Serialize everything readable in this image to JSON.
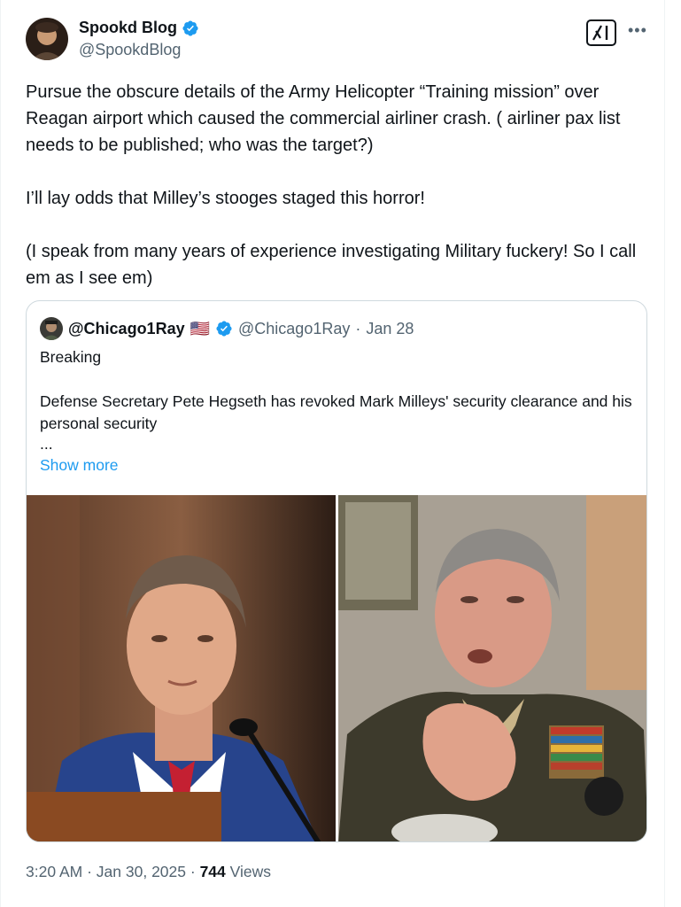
{
  "author": {
    "name": "Spookd Blog",
    "handle": "@SpookdBlog",
    "avatar": "avatar-photo"
  },
  "post": {
    "paragraphs": [
      "Pursue the obscure details of the Army Helicopter “Training mission” over Reagan airport which caused the commercial airliner crash. ( airliner pax list needs to be published; who was the target?)",
      "I’ll lay odds that Milley’s stooges staged this horror!",
      "(I speak from many years of experience investigating Military fuckery! So I call em as I see em)"
    ]
  },
  "quote": {
    "name": "@Chicago1Ray",
    "flag": "🇺🇸",
    "handle": "@Chicago1Ray",
    "sep": "·",
    "date": "Jan 28",
    "lines": [
      "Breaking",
      "",
      "Defense Secretary Pete Hegseth has revoked Mark Milleys' security clearance and his personal security",
      "..."
    ],
    "show_more": "Show more"
  },
  "footer": {
    "time": "3:20 AM",
    "sep1": "·",
    "date": "Jan 30, 2025",
    "sep2": "·",
    "views_count": "744",
    "views_label": "Views"
  },
  "colors": {
    "accent": "#1d9bf0",
    "secondary_text": "#536471",
    "border": "#cfd9de"
  }
}
